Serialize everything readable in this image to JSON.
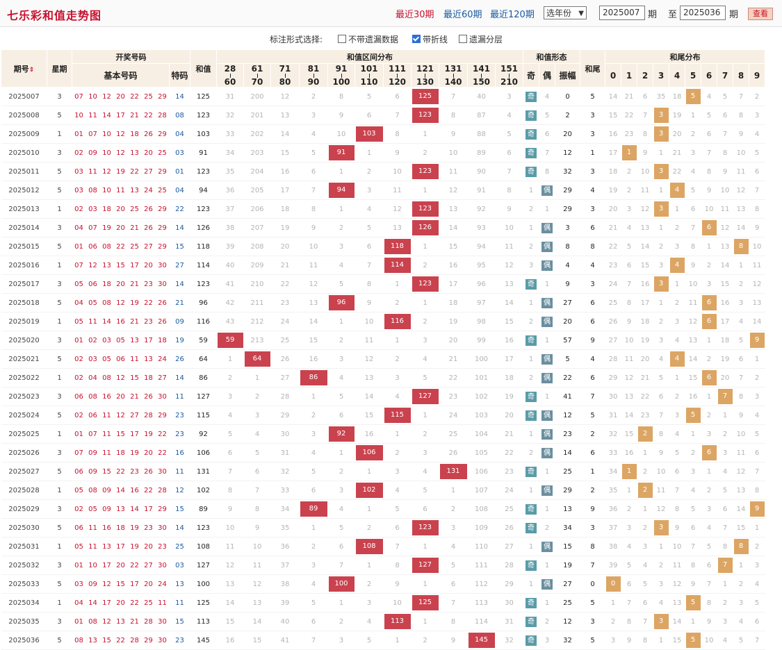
{
  "header": {
    "title": "七乐彩和值走势图",
    "quick_links": [
      "最近30期",
      "最近60期",
      "最近120期"
    ],
    "year_select": "选年份",
    "from_value": "2025007",
    "period_label": "期",
    "to_label": "至",
    "to_value": "2025036",
    "period_label2": "期",
    "query_button": "查看"
  },
  "options": {
    "label": "标注形式选择:",
    "items": [
      {
        "label": "不带遗漏数据",
        "checked": false
      },
      {
        "label": "带折线",
        "checked": true
      },
      {
        "label": "遗漏分层",
        "checked": false
      }
    ]
  },
  "columns": {
    "period": "期号",
    "sort_icon": "sort-icon",
    "weekday": "星期",
    "draw": "开奖号码",
    "basic": "基本号码",
    "special": "特码",
    "sum": "和值",
    "range_dist": "和值区间分布",
    "ranges": [
      [
        "28",
        "60"
      ],
      [
        "61",
        "70"
      ],
      [
        "71",
        "80"
      ],
      [
        "81",
        "90"
      ],
      [
        "91",
        "100"
      ],
      [
        "101",
        "110"
      ],
      [
        "111",
        "120"
      ],
      [
        "121",
        "130"
      ],
      [
        "131",
        "140"
      ],
      [
        "141",
        "150"
      ],
      [
        "151",
        "210"
      ]
    ],
    "form": "和值形态",
    "odd": "奇",
    "even": "偶",
    "amp": "振幅",
    "tail": "和尾",
    "tail_dist": "和尾分布",
    "tail_digits": [
      "0",
      "1",
      "2",
      "3",
      "4",
      "5",
      "6",
      "7",
      "8",
      "9"
    ]
  },
  "colors": {
    "title": "#c8102e",
    "hit": "#c9424e",
    "tail_hit": "#dca563",
    "odd": "#5a9ba8",
    "special": "#1a5aa0"
  },
  "rows": [
    {
      "p": "2025007",
      "w": "3",
      "n": [
        "07",
        "10",
        "12",
        "20",
        "22",
        "25",
        "29"
      ],
      "s": "14",
      "sum": "125",
      "r": [
        "31",
        "200",
        "12",
        "2",
        "8",
        "5",
        "6",
        "125",
        "7",
        "40",
        "3"
      ],
      "odd": "奇",
      "even": "4",
      "amp": "0",
      "tail": "5",
      "t": [
        "14",
        "21",
        "6",
        "35",
        "18",
        "5",
        "4",
        "5",
        "7",
        "2"
      ]
    },
    {
      "p": "2025008",
      "w": "5",
      "n": [
        "10",
        "11",
        "14",
        "17",
        "21",
        "22",
        "28"
      ],
      "s": "08",
      "sum": "123",
      "r": [
        "32",
        "201",
        "13",
        "3",
        "9",
        "6",
        "7",
        "123",
        "8",
        "87",
        "4"
      ],
      "odd": "奇",
      "even": "5",
      "amp": "2",
      "tail": "3",
      "t": [
        "15",
        "22",
        "7",
        "3",
        "19",
        "1",
        "5",
        "6",
        "8",
        "3"
      ]
    },
    {
      "p": "2025009",
      "w": "1",
      "n": [
        "01",
        "07",
        "10",
        "12",
        "18",
        "26",
        "29"
      ],
      "s": "04",
      "sum": "103",
      "r": [
        "33",
        "202",
        "14",
        "4",
        "10",
        "103",
        "8",
        "1",
        "9",
        "88",
        "5"
      ],
      "odd": "奇",
      "even": "6",
      "amp": "20",
      "tail": "3",
      "t": [
        "16",
        "23",
        "8",
        "3",
        "20",
        "2",
        "6",
        "7",
        "9",
        "4"
      ]
    },
    {
      "p": "2025010",
      "w": "3",
      "n": [
        "02",
        "09",
        "10",
        "12",
        "13",
        "20",
        "25"
      ],
      "s": "03",
      "sum": "91",
      "r": [
        "34",
        "203",
        "15",
        "5",
        "91",
        "1",
        "9",
        "2",
        "10",
        "89",
        "6"
      ],
      "odd": "奇",
      "even": "7",
      "amp": "12",
      "tail": "1",
      "t": [
        "17",
        "1",
        "9",
        "1",
        "21",
        "3",
        "7",
        "8",
        "10",
        "5"
      ]
    },
    {
      "p": "2025011",
      "w": "5",
      "n": [
        "03",
        "11",
        "12",
        "19",
        "22",
        "27",
        "29"
      ],
      "s": "01",
      "sum": "123",
      "r": [
        "35",
        "204",
        "16",
        "6",
        "1",
        "2",
        "10",
        "123",
        "11",
        "90",
        "7"
      ],
      "odd": "奇",
      "even": "8",
      "amp": "32",
      "tail": "3",
      "t": [
        "18",
        "2",
        "10",
        "3",
        "22",
        "4",
        "8",
        "9",
        "11",
        "6"
      ]
    },
    {
      "p": "2025012",
      "w": "5",
      "n": [
        "03",
        "08",
        "10",
        "11",
        "13",
        "24",
        "25"
      ],
      "s": "04",
      "sum": "94",
      "r": [
        "36",
        "205",
        "17",
        "7",
        "94",
        "3",
        "11",
        "1",
        "12",
        "91",
        "8"
      ],
      "odd": "1",
      "even": "偶",
      "amp": "29",
      "tail": "4",
      "t": [
        "19",
        "2",
        "11",
        "1",
        "4",
        "5",
        "9",
        "10",
        "12",
        "7"
      ]
    },
    {
      "p": "2025013",
      "w": "1",
      "n": [
        "02",
        "03",
        "18",
        "20",
        "25",
        "26",
        "29"
      ],
      "s": "22",
      "sum": "123",
      "r": [
        "37",
        "206",
        "18",
        "8",
        "1",
        "4",
        "12",
        "123",
        "13",
        "92",
        "9"
      ],
      "odd": "2",
      "even": "1",
      "amp": "29",
      "tail": "3",
      "t": [
        "20",
        "3",
        "12",
        "3",
        "1",
        "6",
        "10",
        "11",
        "13",
        "8"
      ]
    },
    {
      "p": "2025014",
      "w": "3",
      "n": [
        "04",
        "07",
        "19",
        "20",
        "21",
        "26",
        "29"
      ],
      "s": "14",
      "sum": "126",
      "r": [
        "38",
        "207",
        "19",
        "9",
        "2",
        "5",
        "13",
        "126",
        "14",
        "93",
        "10"
      ],
      "odd": "1",
      "even": "偶",
      "amp": "3",
      "tail": "6",
      "t": [
        "21",
        "4",
        "13",
        "1",
        "2",
        "7",
        "6",
        "12",
        "14",
        "9"
      ]
    },
    {
      "p": "2025015",
      "w": "5",
      "n": [
        "01",
        "06",
        "08",
        "22",
        "25",
        "27",
        "29"
      ],
      "s": "15",
      "sum": "118",
      "r": [
        "39",
        "208",
        "20",
        "10",
        "3",
        "6",
        "118",
        "1",
        "15",
        "94",
        "11"
      ],
      "odd": "2",
      "even": "偶",
      "amp": "8",
      "tail": "8",
      "t": [
        "22",
        "5",
        "14",
        "2",
        "3",
        "8",
        "1",
        "13",
        "8",
        "10"
      ]
    },
    {
      "p": "2025016",
      "w": "1",
      "n": [
        "07",
        "12",
        "13",
        "15",
        "17",
        "20",
        "30"
      ],
      "s": "27",
      "sum": "114",
      "r": [
        "40",
        "209",
        "21",
        "11",
        "4",
        "7",
        "114",
        "2",
        "16",
        "95",
        "12"
      ],
      "odd": "3",
      "even": "偶",
      "amp": "4",
      "tail": "4",
      "t": [
        "23",
        "6",
        "15",
        "3",
        "4",
        "9",
        "2",
        "14",
        "1",
        "11"
      ]
    },
    {
      "p": "2025017",
      "w": "3",
      "n": [
        "05",
        "06",
        "18",
        "20",
        "21",
        "23",
        "30"
      ],
      "s": "14",
      "sum": "123",
      "r": [
        "41",
        "210",
        "22",
        "12",
        "5",
        "8",
        "1",
        "123",
        "17",
        "96",
        "13"
      ],
      "odd": "奇",
      "even": "1",
      "amp": "9",
      "tail": "3",
      "t": [
        "24",
        "7",
        "16",
        "3",
        "1",
        "10",
        "3",
        "15",
        "2",
        "12"
      ]
    },
    {
      "p": "2025018",
      "w": "5",
      "n": [
        "04",
        "05",
        "08",
        "12",
        "19",
        "22",
        "26"
      ],
      "s": "21",
      "sum": "96",
      "r": [
        "42",
        "211",
        "23",
        "13",
        "96",
        "9",
        "2",
        "1",
        "18",
        "97",
        "14"
      ],
      "odd": "1",
      "even": "偶",
      "amp": "27",
      "tail": "6",
      "t": [
        "25",
        "8",
        "17",
        "1",
        "2",
        "11",
        "6",
        "16",
        "3",
        "13"
      ]
    },
    {
      "p": "2025019",
      "w": "1",
      "n": [
        "05",
        "11",
        "14",
        "16",
        "21",
        "23",
        "26"
      ],
      "s": "09",
      "sum": "116",
      "r": [
        "43",
        "212",
        "24",
        "14",
        "1",
        "10",
        "116",
        "2",
        "19",
        "98",
        "15"
      ],
      "odd": "2",
      "even": "偶",
      "amp": "20",
      "tail": "6",
      "t": [
        "26",
        "9",
        "18",
        "2",
        "3",
        "12",
        "6",
        "17",
        "4",
        "14"
      ]
    },
    {
      "p": "2025020",
      "w": "3",
      "n": [
        "01",
        "02",
        "03",
        "05",
        "13",
        "17",
        "18"
      ],
      "s": "19",
      "sum": "59",
      "r": [
        "59",
        "213",
        "25",
        "15",
        "2",
        "11",
        "1",
        "3",
        "20",
        "99",
        "16"
      ],
      "odd": "奇",
      "even": "1",
      "amp": "57",
      "tail": "9",
      "t": [
        "27",
        "10",
        "19",
        "3",
        "4",
        "13",
        "1",
        "18",
        "5",
        "9"
      ]
    },
    {
      "p": "2025021",
      "w": "5",
      "n": [
        "02",
        "03",
        "05",
        "06",
        "11",
        "13",
        "24"
      ],
      "s": "26",
      "sum": "64",
      "r": [
        "1",
        "64",
        "26",
        "16",
        "3",
        "12",
        "2",
        "4",
        "21",
        "100",
        "17"
      ],
      "odd": "1",
      "even": "偶",
      "amp": "5",
      "tail": "4",
      "t": [
        "28",
        "11",
        "20",
        "4",
        "4",
        "14",
        "2",
        "19",
        "6",
        "1"
      ]
    },
    {
      "p": "2025022",
      "w": "1",
      "n": [
        "02",
        "04",
        "08",
        "12",
        "15",
        "18",
        "27"
      ],
      "s": "14",
      "sum": "86",
      "r": [
        "2",
        "1",
        "27",
        "86",
        "4",
        "13",
        "3",
        "5",
        "22",
        "101",
        "18"
      ],
      "odd": "2",
      "even": "偶",
      "amp": "22",
      "tail": "6",
      "t": [
        "29",
        "12",
        "21",
        "5",
        "1",
        "15",
        "6",
        "20",
        "7",
        "2"
      ]
    },
    {
      "p": "2025023",
      "w": "3",
      "n": [
        "06",
        "08",
        "16",
        "20",
        "21",
        "26",
        "30"
      ],
      "s": "11",
      "sum": "127",
      "r": [
        "3",
        "2",
        "28",
        "1",
        "5",
        "14",
        "4",
        "127",
        "23",
        "102",
        "19"
      ],
      "odd": "奇",
      "even": "1",
      "amp": "41",
      "tail": "7",
      "t": [
        "30",
        "13",
        "22",
        "6",
        "2",
        "16",
        "1",
        "7",
        "8",
        "3"
      ]
    },
    {
      "p": "2025024",
      "w": "5",
      "n": [
        "02",
        "06",
        "11",
        "12",
        "27",
        "28",
        "29"
      ],
      "s": "23",
      "sum": "115",
      "r": [
        "4",
        "3",
        "29",
        "2",
        "6",
        "15",
        "115",
        "1",
        "24",
        "103",
        "20"
      ],
      "odd": "奇",
      "even": "偶",
      "amp": "12",
      "tail": "5",
      "t": [
        "31",
        "14",
        "23",
        "7",
        "3",
        "5",
        "2",
        "1",
        "9",
        "4"
      ]
    },
    {
      "p": "2025025",
      "w": "1",
      "n": [
        "01",
        "07",
        "11",
        "15",
        "17",
        "19",
        "22"
      ],
      "s": "23",
      "sum": "92",
      "r": [
        "5",
        "4",
        "30",
        "3",
        "92",
        "16",
        "1",
        "2",
        "25",
        "104",
        "21"
      ],
      "odd": "1",
      "even": "偶",
      "amp": "23",
      "tail": "2",
      "t": [
        "32",
        "15",
        "2",
        "8",
        "4",
        "1",
        "3",
        "2",
        "10",
        "5"
      ]
    },
    {
      "p": "2025026",
      "w": "3",
      "n": [
        "07",
        "09",
        "11",
        "18",
        "19",
        "20",
        "22"
      ],
      "s": "16",
      "sum": "106",
      "r": [
        "6",
        "5",
        "31",
        "4",
        "1",
        "106",
        "2",
        "3",
        "26",
        "105",
        "22"
      ],
      "odd": "2",
      "even": "偶",
      "amp": "14",
      "tail": "6",
      "t": [
        "33",
        "16",
        "1",
        "9",
        "5",
        "2",
        "6",
        "3",
        "11",
        "6"
      ]
    },
    {
      "p": "2025027",
      "w": "5",
      "n": [
        "06",
        "09",
        "15",
        "22",
        "23",
        "26",
        "30"
      ],
      "s": "11",
      "sum": "131",
      "r": [
        "7",
        "6",
        "32",
        "5",
        "2",
        "1",
        "3",
        "4",
        "131",
        "106",
        "23"
      ],
      "odd": "奇",
      "even": "1",
      "amp": "25",
      "tail": "1",
      "t": [
        "34",
        "1",
        "2",
        "10",
        "6",
        "3",
        "1",
        "4",
        "12",
        "7"
      ]
    },
    {
      "p": "2025028",
      "w": "1",
      "n": [
        "05",
        "08",
        "09",
        "14",
        "16",
        "22",
        "28"
      ],
      "s": "12",
      "sum": "102",
      "r": [
        "8",
        "7",
        "33",
        "6",
        "3",
        "102",
        "4",
        "5",
        "1",
        "107",
        "24"
      ],
      "odd": "1",
      "even": "偶",
      "amp": "29",
      "tail": "2",
      "t": [
        "35",
        "1",
        "2",
        "11",
        "7",
        "4",
        "2",
        "5",
        "13",
        "8"
      ]
    },
    {
      "p": "2025029",
      "w": "3",
      "n": [
        "02",
        "05",
        "09",
        "13",
        "14",
        "17",
        "29"
      ],
      "s": "15",
      "sum": "89",
      "r": [
        "9",
        "8",
        "34",
        "89",
        "4",
        "1",
        "5",
        "6",
        "2",
        "108",
        "25"
      ],
      "odd": "奇",
      "even": "1",
      "amp": "13",
      "tail": "9",
      "t": [
        "36",
        "2",
        "1",
        "12",
        "8",
        "5",
        "3",
        "6",
        "14",
        "9"
      ]
    },
    {
      "p": "2025030",
      "w": "5",
      "n": [
        "06",
        "11",
        "16",
        "18",
        "19",
        "23",
        "30"
      ],
      "s": "14",
      "sum": "123",
      "r": [
        "10",
        "9",
        "35",
        "1",
        "5",
        "2",
        "6",
        "123",
        "3",
        "109",
        "26"
      ],
      "odd": "奇",
      "even": "2",
      "amp": "34",
      "tail": "3",
      "t": [
        "37",
        "3",
        "2",
        "3",
        "9",
        "6",
        "4",
        "7",
        "15",
        "1"
      ]
    },
    {
      "p": "2025031",
      "w": "1",
      "n": [
        "05",
        "11",
        "13",
        "17",
        "19",
        "20",
        "23"
      ],
      "s": "25",
      "sum": "108",
      "r": [
        "11",
        "10",
        "36",
        "2",
        "6",
        "108",
        "7",
        "1",
        "4",
        "110",
        "27"
      ],
      "odd": "1",
      "even": "偶",
      "amp": "15",
      "tail": "8",
      "t": [
        "38",
        "4",
        "3",
        "1",
        "10",
        "7",
        "5",
        "8",
        "8",
        "2"
      ]
    },
    {
      "p": "2025032",
      "w": "3",
      "n": [
        "01",
        "10",
        "17",
        "20",
        "22",
        "27",
        "30"
      ],
      "s": "03",
      "sum": "127",
      "r": [
        "12",
        "11",
        "37",
        "3",
        "7",
        "1",
        "8",
        "127",
        "5",
        "111",
        "28"
      ],
      "odd": "奇",
      "even": "1",
      "amp": "19",
      "tail": "7",
      "t": [
        "39",
        "5",
        "4",
        "2",
        "11",
        "8",
        "6",
        "7",
        "1",
        "3"
      ]
    },
    {
      "p": "2025033",
      "w": "5",
      "n": [
        "03",
        "09",
        "12",
        "15",
        "17",
        "20",
        "24"
      ],
      "s": "13",
      "sum": "100",
      "r": [
        "13",
        "12",
        "38",
        "4",
        "100",
        "2",
        "9",
        "1",
        "6",
        "112",
        "29"
      ],
      "odd": "1",
      "even": "偶",
      "amp": "27",
      "tail": "0",
      "t": [
        "0",
        "6",
        "5",
        "3",
        "12",
        "9",
        "7",
        "1",
        "2",
        "4"
      ]
    },
    {
      "p": "2025034",
      "w": "1",
      "n": [
        "04",
        "14",
        "17",
        "20",
        "22",
        "25",
        "11"
      ],
      "s": "11",
      "sum": "125",
      "r": [
        "14",
        "13",
        "39",
        "5",
        "1",
        "3",
        "10",
        "125",
        "7",
        "113",
        "30"
      ],
      "odd": "奇",
      "even": "1",
      "amp": "25",
      "tail": "5",
      "t": [
        "1",
        "7",
        "6",
        "4",
        "13",
        "5",
        "8",
        "2",
        "3",
        "5"
      ]
    },
    {
      "p": "2025035",
      "w": "3",
      "n": [
        "01",
        "08",
        "12",
        "13",
        "21",
        "28",
        "30"
      ],
      "s": "15",
      "sum": "113",
      "r": [
        "15",
        "14",
        "40",
        "6",
        "2",
        "4",
        "113",
        "1",
        "8",
        "114",
        "31"
      ],
      "odd": "奇",
      "even": "2",
      "amp": "12",
      "tail": "3",
      "t": [
        "2",
        "8",
        "7",
        "3",
        "14",
        "1",
        "9",
        "3",
        "4",
        "6"
      ]
    },
    {
      "p": "2025036",
      "w": "5",
      "n": [
        "08",
        "13",
        "15",
        "22",
        "28",
        "29",
        "30"
      ],
      "s": "23",
      "sum": "145",
      "r": [
        "16",
        "15",
        "41",
        "7",
        "3",
        "5",
        "1",
        "2",
        "9",
        "145",
        "32"
      ],
      "odd": "奇",
      "even": "3",
      "amp": "32",
      "tail": "5",
      "t": [
        "3",
        "9",
        "8",
        "1",
        "15",
        "5",
        "10",
        "4",
        "5",
        "7"
      ]
    }
  ]
}
